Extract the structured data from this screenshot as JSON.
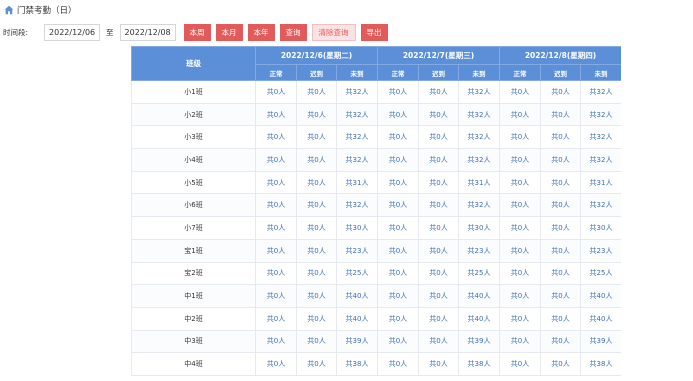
{
  "page": {
    "title": "门禁考勤（日）"
  },
  "filter": {
    "period_label": "时间段:",
    "date_from": "2022/12/06",
    "to_label": "至",
    "date_to": "2022/12/08",
    "buttons": {
      "this_week": "本周",
      "this_month": "本月",
      "this_year": "本年",
      "query": "查询",
      "clear_query": "清除查询",
      "export": "导出"
    }
  },
  "table": {
    "class_header": "班级",
    "dates": [
      "2022/12/6(星期二)",
      "2022/12/7(星期三)",
      "2022/12/8(星期四)"
    ],
    "sub_headers": [
      "正常",
      "迟到",
      "未到"
    ],
    "rows": [
      {
        "name": "小1班",
        "cells": [
          "共0人",
          "共0人",
          "共32人",
          "共0人",
          "共0人",
          "共32人",
          "共0人",
          "共0人",
          "共32人"
        ]
      },
      {
        "name": "小2班",
        "cells": [
          "共0人",
          "共0人",
          "共32人",
          "共0人",
          "共0人",
          "共32人",
          "共0人",
          "共0人",
          "共32人"
        ]
      },
      {
        "name": "小3班",
        "cells": [
          "共0人",
          "共0人",
          "共32人",
          "共0人",
          "共0人",
          "共32人",
          "共0人",
          "共0人",
          "共32人"
        ]
      },
      {
        "name": "小4班",
        "cells": [
          "共0人",
          "共0人",
          "共32人",
          "共0人",
          "共0人",
          "共32人",
          "共0人",
          "共0人",
          "共32人"
        ]
      },
      {
        "name": "小5班",
        "cells": [
          "共0人",
          "共0人",
          "共31人",
          "共0人",
          "共0人",
          "共31人",
          "共0人",
          "共0人",
          "共31人"
        ]
      },
      {
        "name": "小6班",
        "cells": [
          "共0人",
          "共0人",
          "共32人",
          "共0人",
          "共0人",
          "共32人",
          "共0人",
          "共0人",
          "共32人"
        ]
      },
      {
        "name": "小7班",
        "cells": [
          "共0人",
          "共0人",
          "共30人",
          "共0人",
          "共0人",
          "共30人",
          "共0人",
          "共0人",
          "共30人"
        ]
      },
      {
        "name": "宝1班",
        "cells": [
          "共0人",
          "共0人",
          "共23人",
          "共0人",
          "共0人",
          "共23人",
          "共0人",
          "共0人",
          "共23人"
        ]
      },
      {
        "name": "宝2班",
        "cells": [
          "共0人",
          "共0人",
          "共25人",
          "共0人",
          "共0人",
          "共25人",
          "共0人",
          "共0人",
          "共25人"
        ]
      },
      {
        "name": "中1班",
        "cells": [
          "共0人",
          "共0人",
          "共40人",
          "共0人",
          "共0人",
          "共40人",
          "共0人",
          "共0人",
          "共40人"
        ]
      },
      {
        "name": "中2班",
        "cells": [
          "共0人",
          "共0人",
          "共40人",
          "共0人",
          "共0人",
          "共40人",
          "共0人",
          "共0人",
          "共40人"
        ]
      },
      {
        "name": "中3班",
        "cells": [
          "共0人",
          "共0人",
          "共39人",
          "共0人",
          "共0人",
          "共39人",
          "共0人",
          "共0人",
          "共39人"
        ]
      },
      {
        "name": "中4班",
        "cells": [
          "共0人",
          "共0人",
          "共38人",
          "共0人",
          "共0人",
          "共38人",
          "共0人",
          "共0人",
          "共38人"
        ]
      }
    ]
  }
}
